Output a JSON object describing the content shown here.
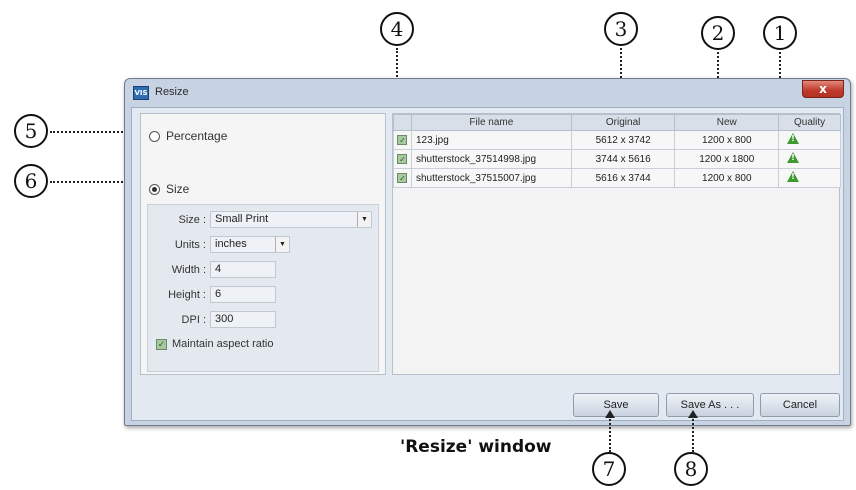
{
  "window": {
    "title": "Resize",
    "app_icon_text": "VIS",
    "close_glyph": "x"
  },
  "mode": {
    "percentage_label": "Percentage",
    "size_label": "Size",
    "selected": "size"
  },
  "settings": {
    "size_label": "Size :",
    "size_value": "Small Print",
    "units_label": "Units :",
    "units_value": "inches",
    "width_label": "Width :",
    "width_value": "4",
    "height_label": "Height :",
    "height_value": "6",
    "dpi_label": "DPI :",
    "dpi_value": "300",
    "maintain_label": "Maintain aspect ratio",
    "maintain_checked": true
  },
  "table": {
    "headers": [
      "File name",
      "Original",
      "New",
      "Quality"
    ],
    "rows": [
      {
        "file": "123.jpg",
        "original": "5612 x 3742",
        "new": "1200 x 800",
        "quality": "warning-icon"
      },
      {
        "file": "shutterstock_37514998.jpg",
        "original": "3744 x 5616",
        "new": "1200 x 1800",
        "quality": "warning-icon"
      },
      {
        "file": "shutterstock_37515007.jpg",
        "original": "5616 x 3744",
        "new": "1200 x 800",
        "quality": "warning-icon"
      }
    ]
  },
  "buttons": {
    "save": "Save",
    "save_as": "Save As . . .",
    "cancel": "Cancel"
  },
  "callouts": {
    "c1": "1",
    "c2": "2",
    "c3": "3",
    "c4": "4",
    "c5": "5",
    "c6": "6",
    "c7": "7",
    "c8": "8"
  },
  "caption": "'Resize' window",
  "colors": {
    "title_close": "#c0392b",
    "quality_warning": "#3c9a2e",
    "checkbox": "#a8c9a0"
  }
}
